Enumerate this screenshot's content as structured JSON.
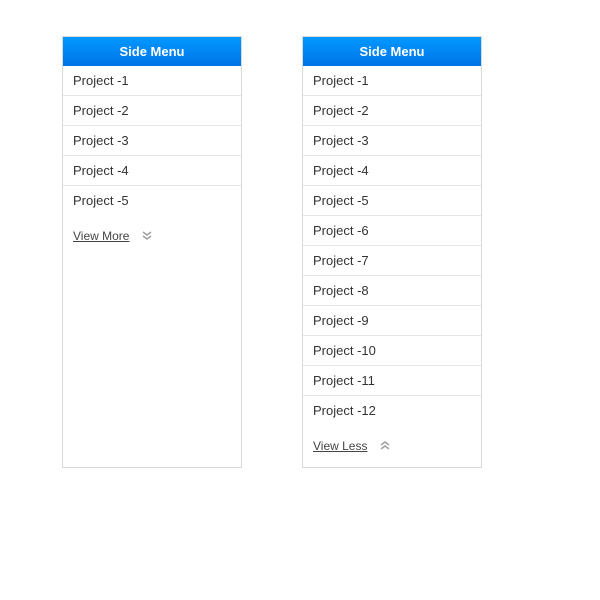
{
  "leftMenu": {
    "title": "Side Menu",
    "items": [
      {
        "label": "Project -1"
      },
      {
        "label": "Project -2"
      },
      {
        "label": "Project -3"
      },
      {
        "label": "Project -4"
      },
      {
        "label": "Project -5"
      }
    ],
    "footerLabel": "View More"
  },
  "rightMenu": {
    "title": "Side Menu",
    "items": [
      {
        "label": "Project -1"
      },
      {
        "label": "Project -2"
      },
      {
        "label": "Project -3"
      },
      {
        "label": "Project -4"
      },
      {
        "label": "Project -5"
      },
      {
        "label": "Project -6"
      },
      {
        "label": "Project -7"
      },
      {
        "label": "Project -8"
      },
      {
        "label": "Project -9"
      },
      {
        "label": "Project -10"
      },
      {
        "label": "Project -11"
      },
      {
        "label": "Project -12"
      }
    ],
    "footerLabel": "View Less"
  }
}
